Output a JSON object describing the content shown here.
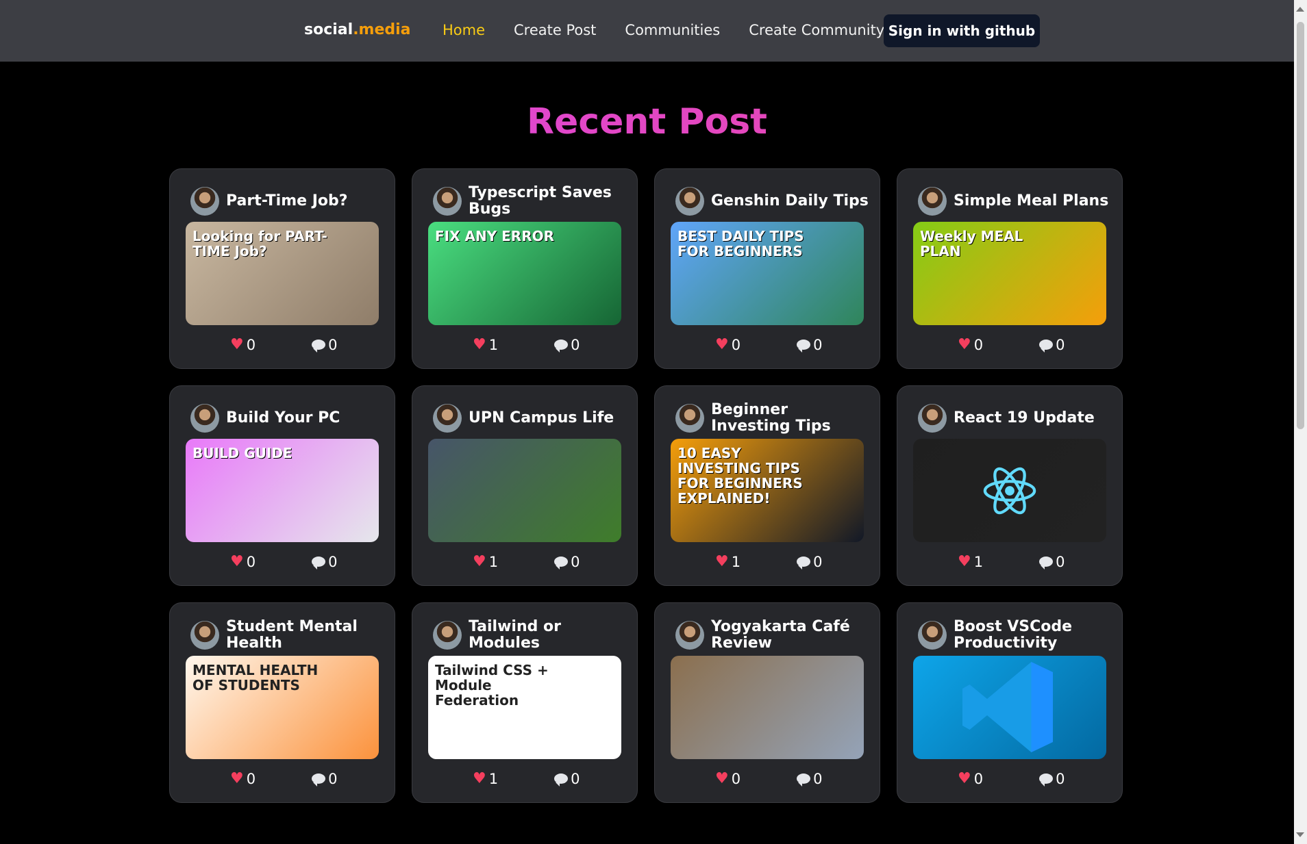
{
  "header": {
    "logo_prefix": "social",
    "logo_accent": ".media",
    "nav": [
      {
        "label": "Home",
        "active": true
      },
      {
        "label": "Create Post"
      },
      {
        "label": "Communities"
      },
      {
        "label": "Create Community"
      }
    ],
    "signin_label": "Sign in with github"
  },
  "page": {
    "title": "Recent Post"
  },
  "posts": [
    {
      "title": "Part-Time Job?",
      "likes": "0",
      "comments": "0",
      "thumb_text": "Looking for PART-TIME Job?",
      "thumb_colors": [
        "#c8b7a0",
        "#8f7d69"
      ]
    },
    {
      "title": "Typescript Saves Bugs",
      "likes": "1",
      "comments": "0",
      "thumb_text": "FIX ANY ERROR",
      "thumb_colors": [
        "#4ade80",
        "#166534"
      ]
    },
    {
      "title": "Genshin Daily Tips",
      "likes": "0",
      "comments": "0",
      "thumb_text": "BEST DAILY TIPS FOR BEGINNERS",
      "thumb_colors": [
        "#60a5fa",
        "#2f855a"
      ]
    },
    {
      "title": "Simple Meal Plans",
      "likes": "0",
      "comments": "0",
      "thumb_text": "Weekly MEAL PLAN",
      "thumb_colors": [
        "#84cc16",
        "#f59e0b"
      ]
    },
    {
      "title": "Build Your PC",
      "likes": "0",
      "comments": "0",
      "thumb_text": "BUILD GUIDE",
      "thumb_colors": [
        "#e879f9",
        "#e5e7eb"
      ]
    },
    {
      "title": "UPN Campus Life",
      "likes": "1",
      "comments": "0",
      "thumb_text": "",
      "thumb_colors": [
        "#475569",
        "#3f7d2a"
      ]
    },
    {
      "title": "Beginner Investing Tips",
      "likes": "1",
      "comments": "0",
      "thumb_text": "10 EASY INVESTING TIPS FOR BEGINNERS EXPLAINED!",
      "thumb_colors": [
        "#f59e0b",
        "#111827"
      ]
    },
    {
      "title": "React 19 Update",
      "likes": "1",
      "comments": "0",
      "thumb_text": "",
      "thumb_colors": [
        "#1f1f1f",
        "#222"
      ]
    },
    {
      "title": "Student Mental Health",
      "likes": "0",
      "comments": "0",
      "thumb_text": "MENTAL HEALTH OF STUDENTS",
      "thumb_colors": [
        "#fff7ed",
        "#fb923c"
      ]
    },
    {
      "title": "Tailwind or Modules",
      "likes": "1",
      "comments": "0",
      "thumb_text": "Tailwind CSS + Module Federation",
      "thumb_colors": [
        "#ffffff",
        "#ffffff"
      ]
    },
    {
      "title": "Yogyakarta Café Review",
      "likes": "0",
      "comments": "0",
      "thumb_text": "",
      "thumb_colors": [
        "#8b6f4e",
        "#94a3b8"
      ]
    },
    {
      "title": "Boost VSCode Productivity",
      "likes": "0",
      "comments": "0",
      "thumb_text": "",
      "thumb_colors": [
        "#0ea5e9",
        "#0369a1"
      ]
    }
  ]
}
